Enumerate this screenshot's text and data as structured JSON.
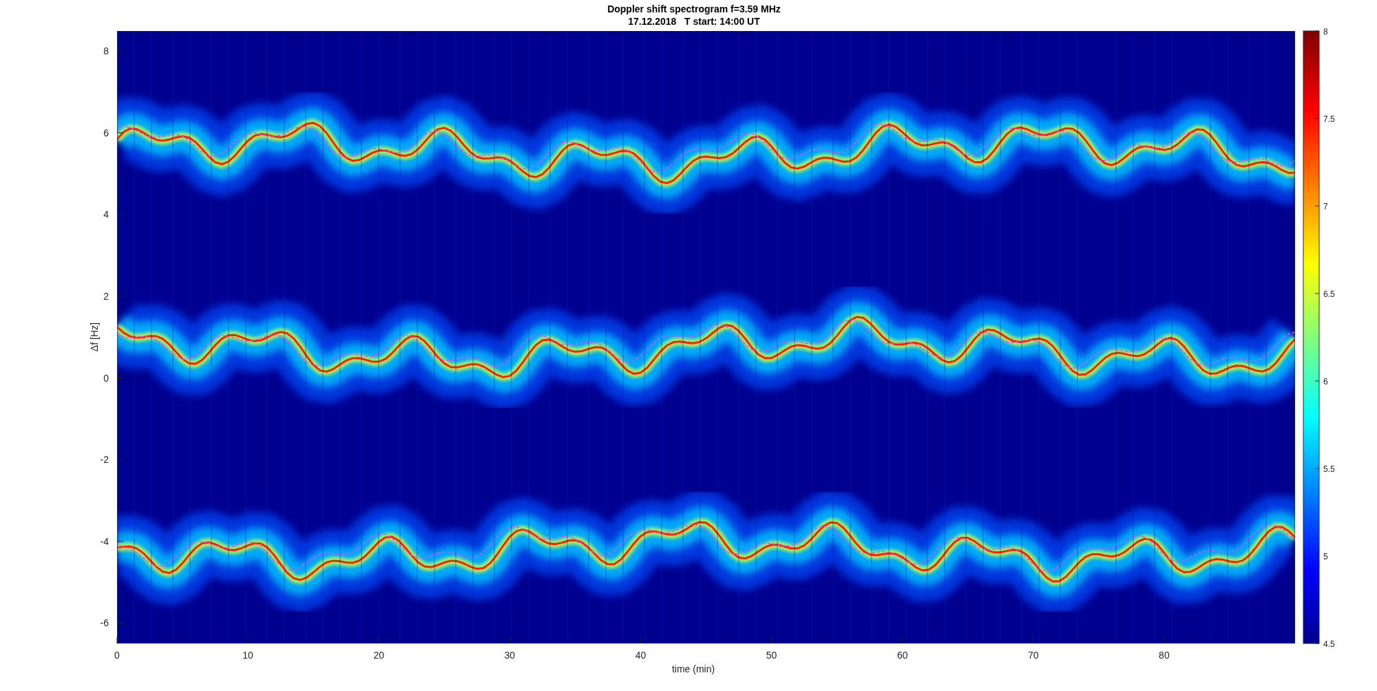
{
  "figure": {
    "title": "Doppler shift spectrogram f=3.59 MHz",
    "subtitle": "17.12.2018   T start: 14:00 UT",
    "xlabel": "time (min)",
    "ylabel": "Δf [Hz]",
    "x_ticks": [
      "0",
      "10",
      "20",
      "30",
      "40",
      "50",
      "60",
      "70",
      "80"
    ],
    "y_ticks": [
      "8",
      "6",
      "4",
      "2",
      "0",
      "-2",
      "-4",
      "-6"
    ],
    "colorbar_ticks": [
      "8",
      "7.5",
      "7",
      "6.5",
      "6",
      "5.5",
      "5",
      "4.5"
    ]
  }
}
